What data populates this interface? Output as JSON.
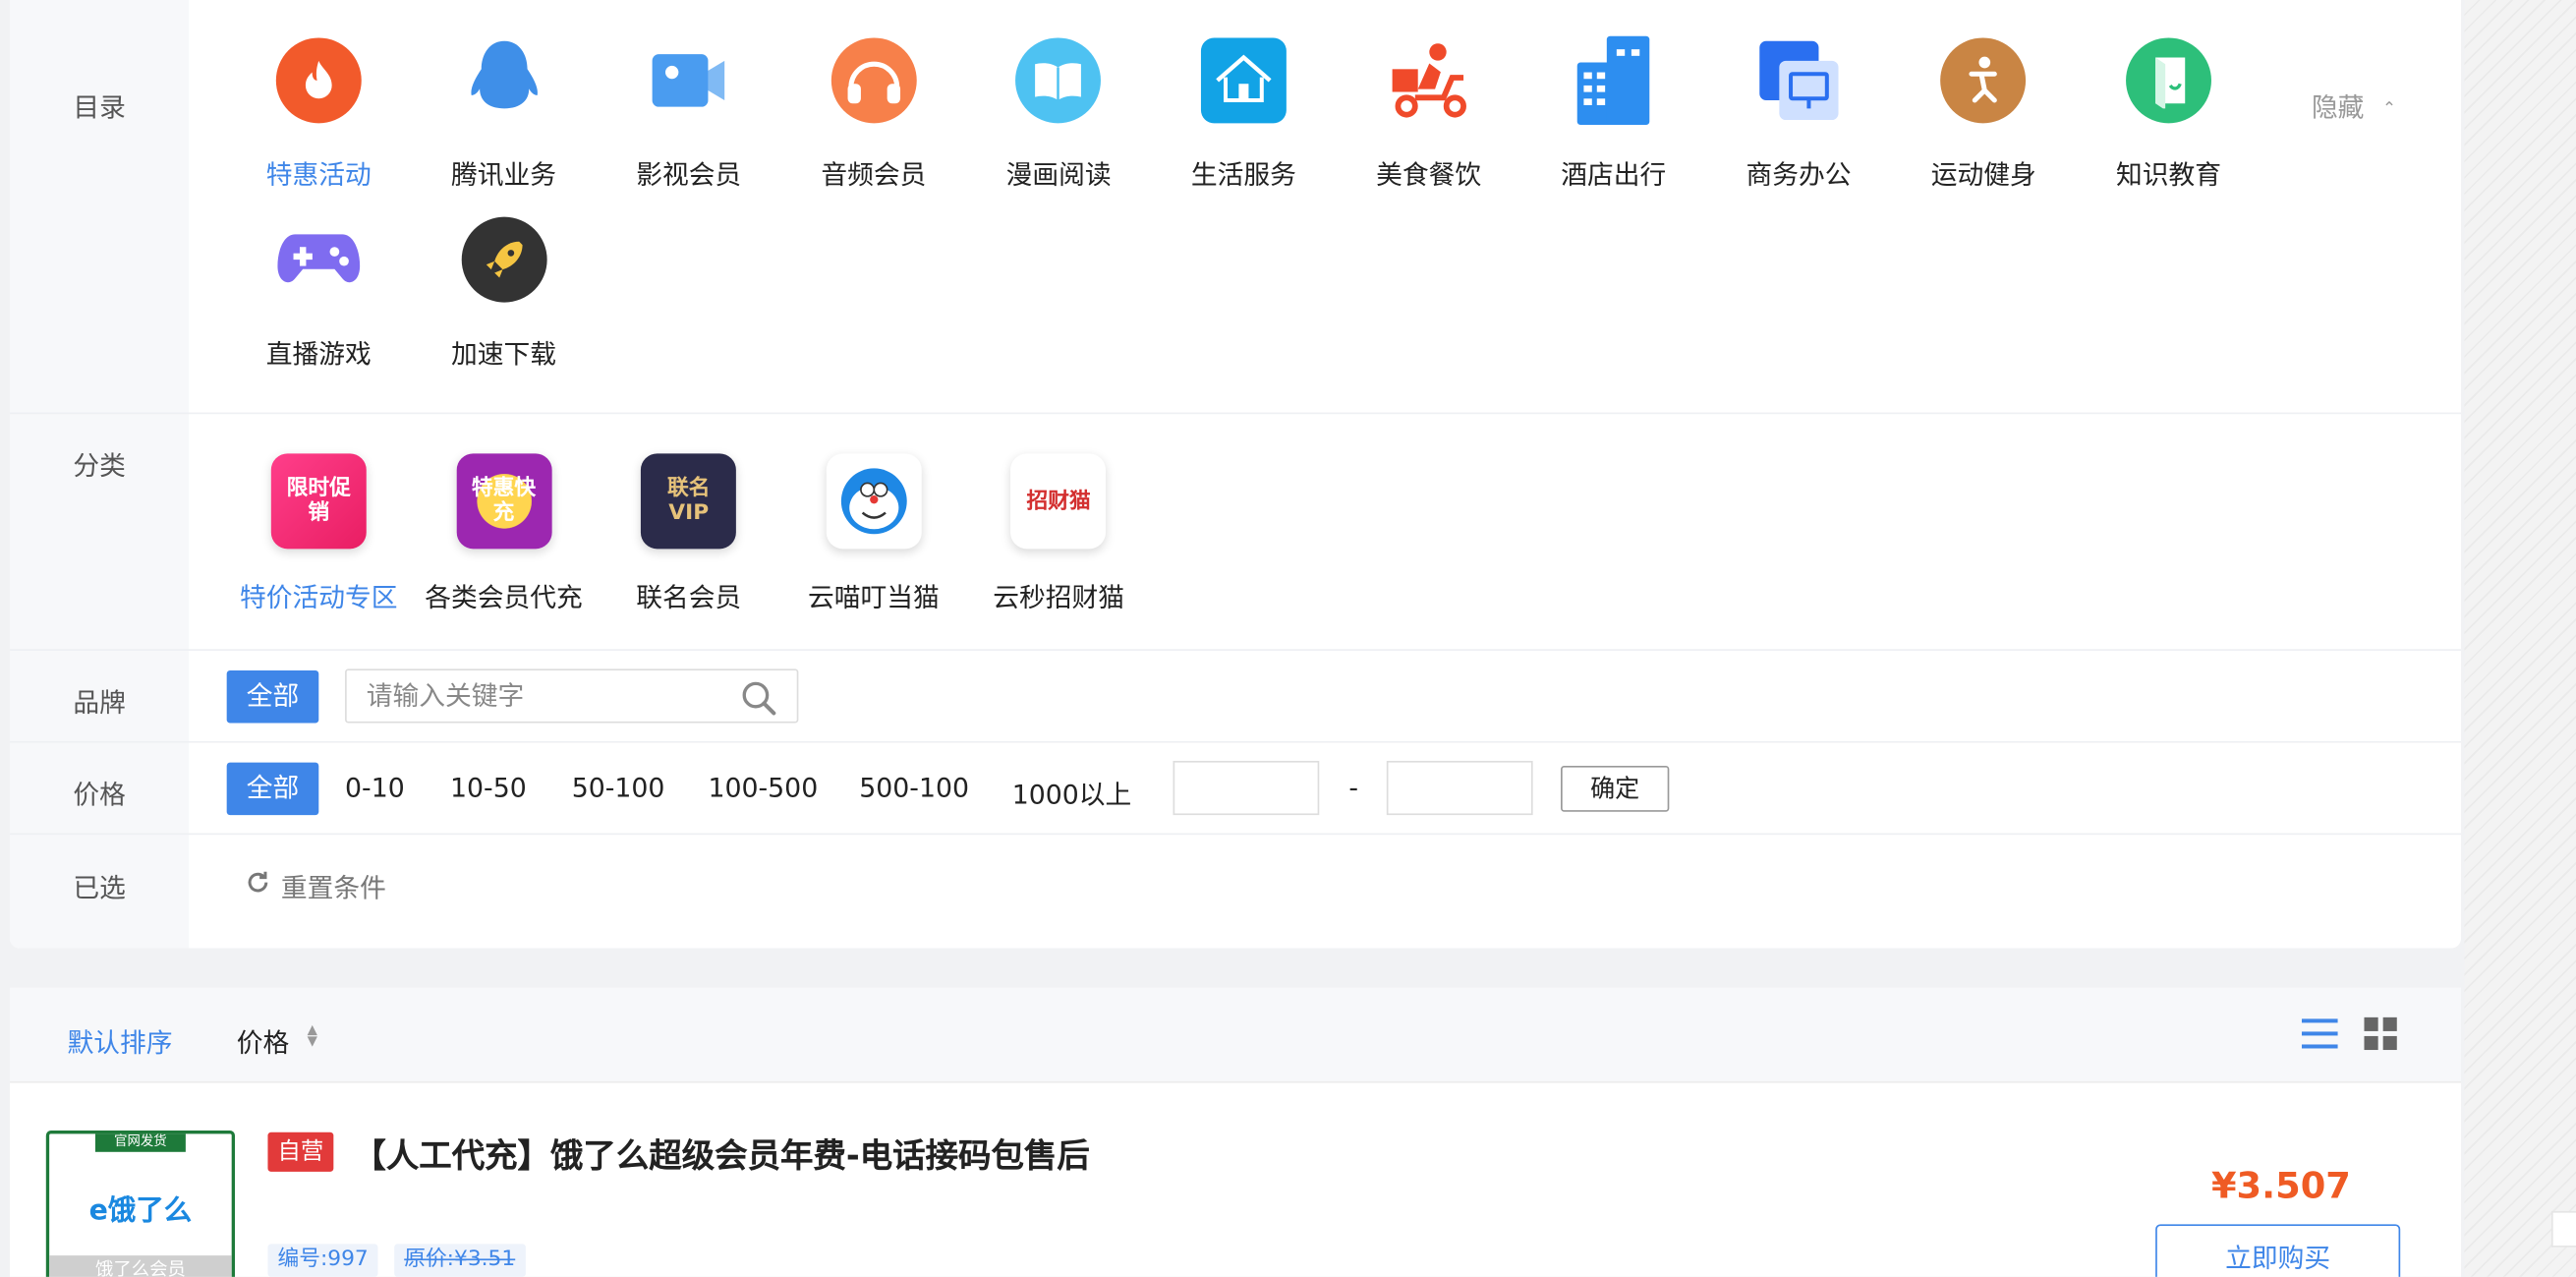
{
  "catalog": {
    "label": "目录",
    "hide_label": "隐藏",
    "items": [
      {
        "label": "特惠活动",
        "icon": "fire-icon",
        "color": "#f25a2b",
        "active": true
      },
      {
        "label": "腾讯业务",
        "icon": "penguin-icon",
        "color": "#3f8fe8"
      },
      {
        "label": "影视会员",
        "icon": "video-camera-icon",
        "color": "#4a9cf0"
      },
      {
        "label": "音频会员",
        "icon": "headphones-icon",
        "color": "#f7804a"
      },
      {
        "label": "漫画阅读",
        "icon": "open-book-icon",
        "color": "#4ec2f2"
      },
      {
        "label": "生活服务",
        "icon": "house-icon",
        "color": "#12a3e6"
      },
      {
        "label": "美食餐饮",
        "icon": "delivery-scooter-icon",
        "color": "#f04a2a"
      },
      {
        "label": "酒店出行",
        "icon": "building-icon",
        "color": "#2d8ef0"
      },
      {
        "label": "商务办公",
        "icon": "monitor-icon",
        "color": "#2a6ff0"
      },
      {
        "label": "运动健身",
        "icon": "fitness-icon",
        "color": "#c98544"
      },
      {
        "label": "知识教育",
        "icon": "notebook-icon",
        "color": "#2dbf7a"
      },
      {
        "label": "直播游戏",
        "icon": "gamepad-icon",
        "color": "#7f6cf0"
      },
      {
        "label": "加速下载",
        "icon": "rocket-icon",
        "color": "#333333"
      }
    ]
  },
  "category": {
    "label": "分类",
    "items": [
      {
        "label": "特价活动专区",
        "icon": "limited-sale-icon",
        "icon_text": "限时促销",
        "active": true
      },
      {
        "label": "各类会员代充",
        "icon": "special-recharge-icon",
        "icon_text": "特惠快充"
      },
      {
        "label": "联名会员",
        "icon": "vip-diamond-icon",
        "icon_text": "联名VIP"
      },
      {
        "label": "云喵叮当猫",
        "icon": "doraemon-icon",
        "icon_text": ""
      },
      {
        "label": "云秒招财猫",
        "icon": "lucky-cat-icon",
        "icon_text": "招财猫"
      }
    ]
  },
  "brand": {
    "label": "品牌",
    "all_label": "全部",
    "search_placeholder": "请输入关键字"
  },
  "price": {
    "label": "价格",
    "all_label": "全部",
    "options": [
      "0-10",
      "10-50",
      "50-100",
      "100-500",
      "500-100",
      "1000以上"
    ],
    "dash": "-",
    "confirm_label": "确定"
  },
  "selected": {
    "label": "已选",
    "reset_label": "重置条件"
  },
  "sortbar": {
    "default_label": "默认排序",
    "price_label": "价格",
    "sort_arrows": "▲▼"
  },
  "product": {
    "thumb_ribbon": "官网发货",
    "thumb_logo": "e饿了么",
    "thumb_caption": "饿了么会员",
    "badge": "自营",
    "title": "【人工代充】饿了么超级会员年费-电话接码包售后",
    "id_tag": "编号:997",
    "orig_price_tag": "原价:¥3.51",
    "price": "¥3.507",
    "buy_label": "立即购买"
  },
  "colors": {
    "accent": "#3f86e8",
    "price": "#ef5b24",
    "self_badge": "#e23a3a"
  }
}
